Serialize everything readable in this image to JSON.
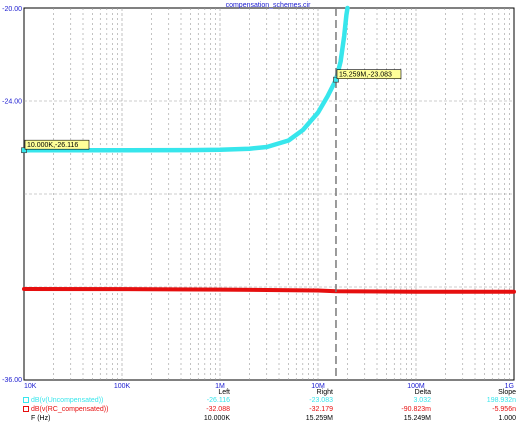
{
  "chart_data": {
    "type": "line",
    "title": "compensation_schemes.cir",
    "x_scale": "log",
    "xlim": [
      10000,
      1000000000
    ],
    "ylim": [
      -36,
      -20
    ],
    "x_tick_labels": [
      "10K",
      "100K",
      "1M",
      "10M",
      "100M",
      "1G"
    ],
    "y_tick_labels": [
      "-20.00",
      "-24.00",
      "-36.00"
    ],
    "grid": true,
    "series": [
      {
        "name": "dB(v(Uncompensated))",
        "color": "#37e6ec",
        "points": [
          [
            10000,
            -26.116
          ],
          [
            100000,
            -26.116
          ],
          [
            500000,
            -26.11
          ],
          [
            1000000,
            -26.1
          ],
          [
            2000000,
            -26.05
          ],
          [
            3000000,
            -25.98
          ],
          [
            5000000,
            -25.7
          ],
          [
            7000000,
            -25.25
          ],
          [
            10000000,
            -24.5
          ],
          [
            12500000,
            -23.8
          ],
          [
            15259000,
            -23.083
          ],
          [
            17000000,
            -22.3
          ],
          [
            18500000,
            -21.2
          ],
          [
            19500000,
            -20.3
          ],
          [
            20000000,
            -20
          ]
        ]
      },
      {
        "name": "dB(v(RC_compensated))",
        "color": "#e60f0f",
        "points": [
          [
            10000,
            -32.088
          ],
          [
            100000,
            -32.09
          ],
          [
            1000000,
            -32.11
          ],
          [
            10000000,
            -32.15
          ],
          [
            15259000,
            -32.179
          ],
          [
            100000000,
            -32.2
          ],
          [
            1000000000,
            -32.2
          ]
        ]
      }
    ],
    "cursor": {
      "x": 15259000,
      "label": "15.259M,-23.083"
    },
    "markers": [
      {
        "x": 10000,
        "y": -26.116,
        "label": "10.000K,-26.116"
      },
      {
        "x": 15259000,
        "y": -23.083,
        "label": "15.259M,-23.083"
      }
    ],
    "table": {
      "headers": [
        "Left",
        "Right",
        "Delta",
        "Slope"
      ],
      "rows": [
        {
          "label": "dB(v(Uncompensated))",
          "color": "#37e6ec",
          "values": [
            "-26.116",
            "-23.083",
            "3.032",
            "198.932n"
          ]
        },
        {
          "label": "dB(v(RC_compensated))",
          "color": "#e60f0f",
          "values": [
            "-32.088",
            "-32.179",
            "-90.823m",
            "-5.956n"
          ]
        },
        {
          "label": "F (Hz)",
          "color": "#000000",
          "values": [
            "10.000K",
            "15.259M",
            "15.249M",
            "1.000"
          ]
        }
      ]
    }
  }
}
